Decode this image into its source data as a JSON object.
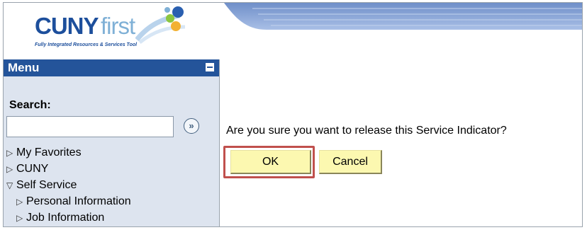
{
  "header": {
    "logo_cuny": "CUNY",
    "logo_first": "first",
    "logo_tagline": "Fully Integrated Resources & Services Tool"
  },
  "menu": {
    "title": "Menu",
    "search_label": "Search:",
    "search_value": "",
    "items": [
      {
        "label": "My Favorites",
        "state": "collapsed",
        "level": 0
      },
      {
        "label": "CUNY",
        "state": "collapsed",
        "level": 0
      },
      {
        "label": "Self Service",
        "state": "expanded",
        "level": 0
      },
      {
        "label": "Personal Information",
        "state": "collapsed",
        "level": 1
      },
      {
        "label": "Job Information",
        "state": "collapsed",
        "level": 1
      }
    ]
  },
  "dialog": {
    "prompt": "Are you sure you want to release this Service Indicator?",
    "ok_label": "OK",
    "cancel_label": "Cancel"
  },
  "colors": {
    "menu_header": "#24549a",
    "menu_bg": "#dde4ef",
    "button_bg": "#fcf8b0",
    "highlight": "#c0504d"
  },
  "icons": {
    "collapse": "minus-box-icon",
    "search_go": "double-chevron-right-icon",
    "collapsed_node": "triangle-right-icon",
    "expanded_node": "triangle-down-icon"
  }
}
